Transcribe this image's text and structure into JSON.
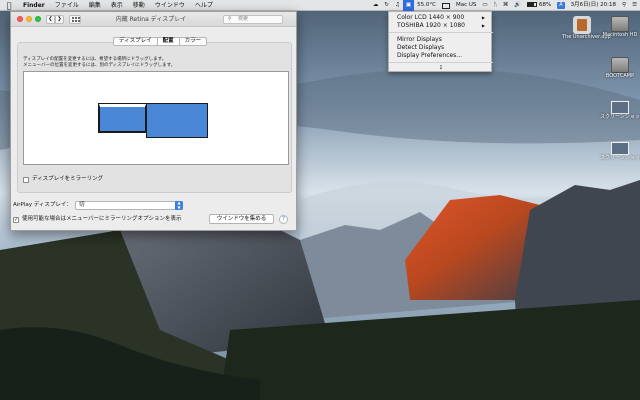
{
  "menubar": {
    "apple_icon": "apple-icon",
    "items": [
      "Finder",
      "ファイル",
      "編集",
      "表示",
      "移動",
      "ウインドウ",
      "ヘルプ"
    ],
    "status": {
      "display_menu_icon": "display-icon",
      "temperature": "55.0°C",
      "mac_label": "Mac US",
      "battery": "68%",
      "input_badge": "A",
      "datetime": "3月6日(日)  20:18"
    }
  },
  "display_menu": {
    "items": [
      {
        "label": "Color LCD 1440  ×  900",
        "has_submenu": true
      },
      {
        "label": "TOSHIBA 1920  ×  1080",
        "has_submenu": true
      },
      {
        "label": "Mirror Displays",
        "has_submenu": false
      },
      {
        "label": "Detect Displays",
        "has_submenu": false
      },
      {
        "label": "Display Preferences...",
        "has_submenu": false
      }
    ],
    "more_icon": "chevron-down-icon"
  },
  "window": {
    "title": "内蔵 Retina ディスプレイ",
    "search_placeholder": "検索",
    "tabs": [
      {
        "label": "ディスプレイ",
        "selected": false
      },
      {
        "label": "配置",
        "selected": true
      },
      {
        "label": "カラー",
        "selected": false
      }
    ],
    "instructions": [
      "ディスプレイの配置を変更するには、希望する場所にドラッグします。",
      "メニューバーの位置を変更するには、別のディスプレイにドラッグします。"
    ],
    "mirror_label": "ディスプレイをミラーリング",
    "mirror_checked": false,
    "airplay_label": "AirPlay ディスプレイ：",
    "airplay_value": "切",
    "show_options_label": "使用可能な場合はメニューバーにミラーリングオプションを表示",
    "show_options_checked": true,
    "gather_button": "ウインドウを集める",
    "help_label": "?"
  },
  "desktop": {
    "icons": [
      {
        "label": "The Unarchiver.app",
        "kind": "app-icon"
      },
      {
        "label": "Macintosh HD",
        "kind": "drive-icon"
      },
      {
        "label": "BOOTCAMP",
        "kind": "drive-icon"
      },
      {
        "label": "スクリーンショット 2...7.png",
        "kind": "screenshot-icon"
      },
      {
        "label": "スクリーンショット 2...7.png",
        "kind": "screenshot-icon"
      }
    ]
  },
  "colors": {
    "accent": "#2f6ce0",
    "display_blue": "#4a87d6",
    "close": "#fc5f57",
    "minimize": "#fdbc2e",
    "zoom": "#28c841"
  }
}
